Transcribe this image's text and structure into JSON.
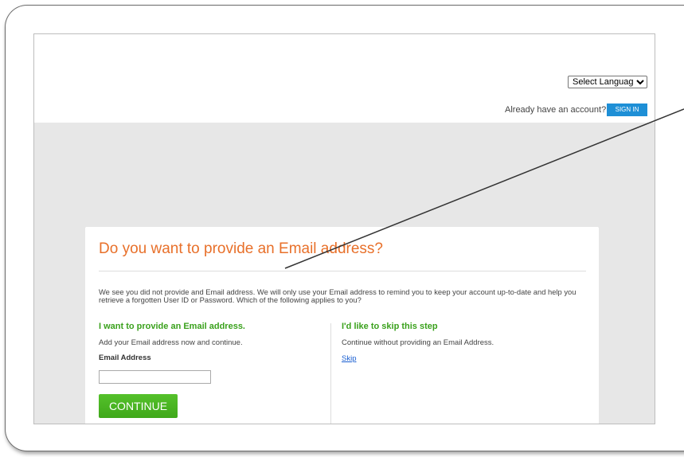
{
  "header": {
    "language_select": "Select Language",
    "have_account_text": "Already have an account?",
    "signin_label": "SIGN IN"
  },
  "card": {
    "title": "Do you want to provide an Email address?",
    "intro": "We see you did not provide and Email address. We will only use your Email address to remind you to keep your account up-to-date and help you retrieve a forgotten User ID or Password. Which of the following applies to you?",
    "left": {
      "heading": "I want to provide an Email address.",
      "description": "Add your Email address now and continue.",
      "field_label": "Email Address",
      "email_value": "",
      "continue_label": "CONTINUE"
    },
    "right": {
      "heading": "I'd like to skip this step",
      "description": "Continue without providing an Email Address.",
      "skip_label": "Skip"
    }
  },
  "colors": {
    "heading_orange": "#e8702a",
    "subheading_green": "#3aa11c",
    "button_green": "#4cb523",
    "signin_blue": "#1e8fd6",
    "link_blue": "#1a5fd1",
    "band_gray": "#e7e7e7"
  }
}
